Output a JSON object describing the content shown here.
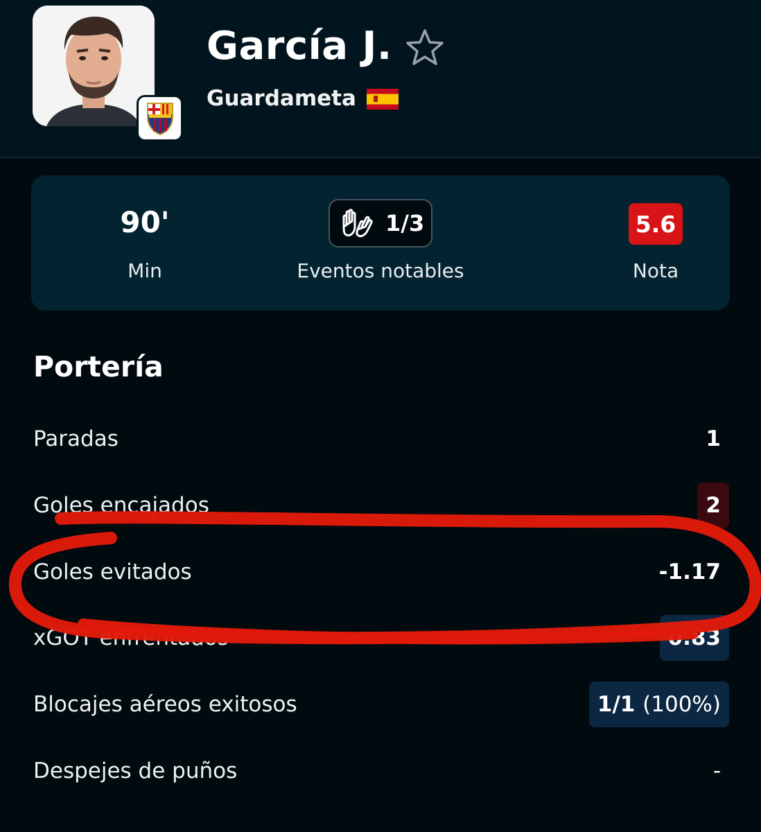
{
  "player": {
    "name": "García J.",
    "position": "Guardameta",
    "favorite_icon": "star-outline-icon",
    "flag_icon": "spain-flag-icon",
    "team_badge": "fc-barcelona-crest-icon"
  },
  "summary": {
    "minutes": {
      "value": "90'",
      "label": "Min"
    },
    "events": {
      "icon": "goalkeeper-gloves-icon",
      "value": "1/3",
      "label": "Eventos notables"
    },
    "rating": {
      "value": "5.6",
      "label": "Nota",
      "color": "#d81417"
    }
  },
  "section": {
    "title": "Portería",
    "stats": [
      {
        "label": "Paradas",
        "value": "1"
      },
      {
        "label": "Goles encajados",
        "value": "2",
        "highlight": "#3a0a10"
      },
      {
        "label": "Goles evitados",
        "value": "-1.17"
      },
      {
        "label": "xGOT enfrentados",
        "value": "0.83",
        "highlight": "#0b2742"
      },
      {
        "label": "Blocajes aéreos exitosos",
        "value_main": "1/1",
        "value_extra": "(100%)",
        "highlight": "#0b2742"
      },
      {
        "label": "Despejes de puños",
        "value": "-"
      }
    ]
  },
  "colors": {
    "background": "#010a0f",
    "header": "#02151e",
    "card": "#032330",
    "annotation": "#e01a0a"
  }
}
